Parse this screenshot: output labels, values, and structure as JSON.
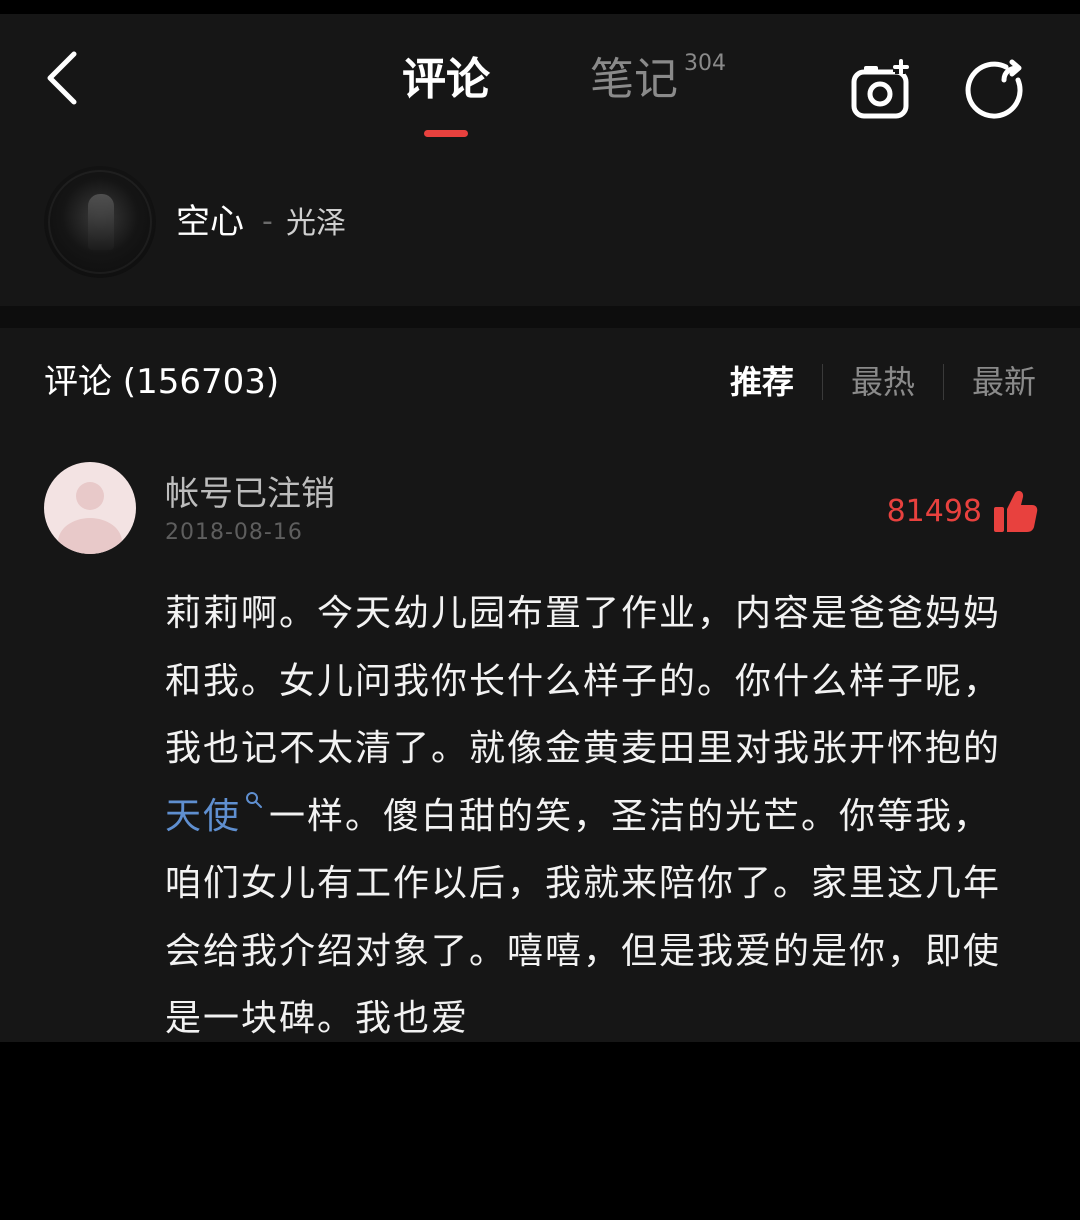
{
  "header": {
    "tabs": [
      {
        "label": "评论",
        "active": true
      },
      {
        "label": "笔记",
        "badge": "304",
        "active": false
      }
    ],
    "icons": [
      "back-arrow-icon",
      "camera-plus-icon",
      "share-icon"
    ],
    "accent_color": "#e8413e"
  },
  "song": {
    "title": "空心",
    "separator": "-",
    "artist": "光泽"
  },
  "comments_section": {
    "title": "评论 (156703)",
    "sort_tabs": [
      {
        "label": "推荐",
        "active": true
      },
      {
        "label": "最热",
        "active": false
      },
      {
        "label": "最新",
        "active": false
      }
    ]
  },
  "comment": {
    "username": "帐号已注销",
    "date": "2018-08-16",
    "likes": "81498",
    "like_color": "#e8413e",
    "text_before_keyword": "莉莉啊。今天幼儿园布置了作业，内容是爸爸妈妈和我。女儿问我你长什么样子的。你什么样子呢，我也记不太清了。就像金黄麦田里对我张开怀抱的",
    "keyword": "天使",
    "keyword_color": "#5f8fd0",
    "text_after_keyword": "一样。傻白甜的笑，圣洁的光芒。你等我，咱们女儿有工作以后，我就来陪你了。家里这几年会给我介绍对象了。嘻嘻，但是我爱的是你，即使是一块碑。我也爱"
  }
}
